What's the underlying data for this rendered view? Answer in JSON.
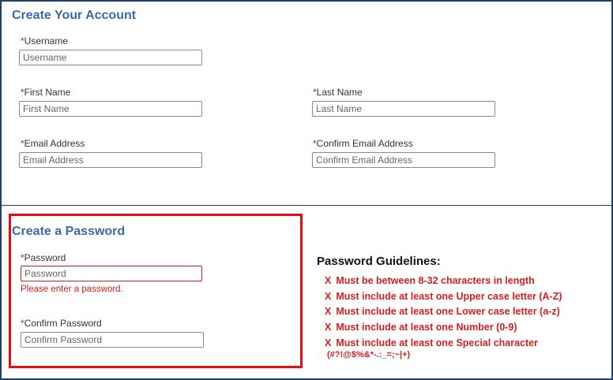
{
  "account": {
    "title": "Create Your Account",
    "required_mark": "*",
    "username": {
      "label": "Username",
      "placeholder": "Username",
      "value": ""
    },
    "first_name": {
      "label": "First Name",
      "placeholder": "First Name",
      "value": ""
    },
    "last_name": {
      "label": "Last Name",
      "placeholder": "Last Name",
      "value": ""
    },
    "email": {
      "label": "Email Address",
      "placeholder": "Email Address",
      "value": ""
    },
    "confirm_email": {
      "label": "Confirm Email Address",
      "placeholder": "Confirm Email Address",
      "value": ""
    }
  },
  "password_section": {
    "title": "Create a Password",
    "password": {
      "label": "Password",
      "placeholder": "Password",
      "value": "",
      "error": "Please enter a password."
    },
    "confirm_password": {
      "label": "Confirm Password",
      "placeholder": "Confirm Password",
      "value": ""
    }
  },
  "guidelines": {
    "title": "Password Guidelines:",
    "mark": "X",
    "rules": [
      "Must be between 8-32 characters in length",
      "Must include at least one Upper case letter (A-Z)",
      "Must include at least one Lower case letter (a-z)",
      "Must include at least one Number (0-9)",
      "Must include at least one Special character"
    ],
    "special_chars": "(#?!@$%&*-.:_=;~|+)"
  },
  "colors": {
    "title": "#3a6aa8",
    "error": "#d21f1f",
    "highlight": "#e10f0f",
    "border": "#1f3f6e"
  }
}
